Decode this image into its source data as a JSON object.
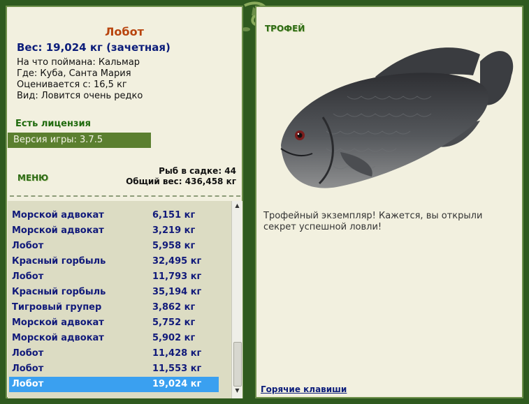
{
  "fish": {
    "name": "Лобот",
    "weight_line": "Вес: 19,024 кг (зачетная)",
    "bait_line": "На что поймана: Кальмар",
    "where_line": "Где: Куба, Санта Мария",
    "price_line": "Оценивается с: 16,5 кг",
    "kind_line": "Вид: Ловится очень редко"
  },
  "license": "Есть лицензия",
  "version": "Версия игры: 3.7.5",
  "menu_label": "МЕНЮ",
  "net": {
    "count_line": "Рыб в садке: 44",
    "weight_line": "Общий вес: 436,458 кг"
  },
  "catch_list": [
    {
      "name": "Морской адвокат",
      "weight": "6,151 кг"
    },
    {
      "name": "Морской адвокат",
      "weight": "3,219 кг"
    },
    {
      "name": "Лобот",
      "weight": "5,958 кг"
    },
    {
      "name": "Красный горбыль",
      "weight": "32,495 кг"
    },
    {
      "name": "Лобот",
      "weight": "11,793 кг"
    },
    {
      "name": "Красный горбыль",
      "weight": "35,194 кг"
    },
    {
      "name": "Тигровый групер",
      "weight": "3,862 кг"
    },
    {
      "name": "Морской адвокат",
      "weight": "5,752 кг"
    },
    {
      "name": "Морской адвокат",
      "weight": "5,902 кг"
    },
    {
      "name": "Лобот",
      "weight": "11,428 кг"
    },
    {
      "name": "Лобот",
      "weight": "11,553 кг"
    },
    {
      "name": "Лобот",
      "weight": "19,024 кг"
    }
  ],
  "selected_index": 11,
  "trophy": {
    "title": "ТРОФЕЙ",
    "text": "Трофейный экземпляр! Кажется, вы открыли секрет успешной ловли!"
  },
  "hotkeys_label": "Горячие клавиши",
  "colors": {
    "frame": "#2f5a1f",
    "panel": "#f2f0df",
    "list_bg": "#dcdcc3",
    "selected": "#3aa0f0",
    "fish_name": "#b8440e",
    "weight": "#0c1d7a",
    "license": "#1f6a0d"
  }
}
